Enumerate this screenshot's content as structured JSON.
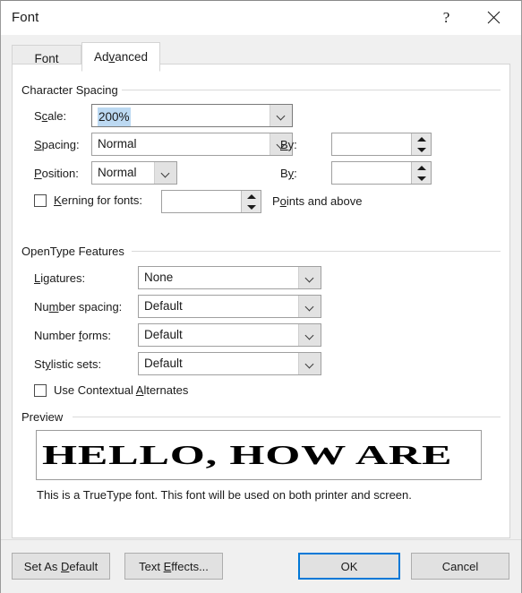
{
  "window": {
    "title": "Font",
    "help_icon": "question-mark-icon",
    "close_icon": "close-icon"
  },
  "tabs": [
    {
      "label": "Font",
      "accel": "n",
      "active": false
    },
    {
      "label": "Advanced",
      "accel": "v",
      "active": true
    }
  ],
  "character_spacing": {
    "group_label": "Character Spacing",
    "scale": {
      "label": "Scale:",
      "accel": "c",
      "value": "200%",
      "selected": true,
      "arrow_icon": "chevron-down-icon"
    },
    "spacing": {
      "label": "Spacing:",
      "accel": "S",
      "value": "Normal",
      "arrow_icon": "chevron-down-icon",
      "by_label": "By:",
      "by_value": "",
      "by_accel": "B"
    },
    "position": {
      "label": "Position:",
      "accel": "P",
      "value": "Normal",
      "arrow_icon": "chevron-down-icon",
      "by_label": "By:",
      "by_value": "",
      "by_accel": "y"
    },
    "kerning": {
      "label": "Kerning for fonts:",
      "accel": "K",
      "checked": false,
      "value": "",
      "suffix": "Points and above",
      "suffix_accel": "o"
    }
  },
  "opentype": {
    "group_label": "OpenType Features",
    "fields": [
      {
        "label": "Ligatures:",
        "accel": "L",
        "value": "None",
        "arrow_icon": "chevron-down-icon"
      },
      {
        "label": "Number spacing:",
        "accel": "m",
        "value": "Default",
        "arrow_icon": "chevron-down-icon"
      },
      {
        "label": "Number forms:",
        "accel": "f",
        "value": "Default",
        "arrow_icon": "chevron-down-icon"
      },
      {
        "label": "Stylistic sets:",
        "accel": "y",
        "value": "Default",
        "arrow_icon": "chevron-down-icon"
      }
    ],
    "contextual_alternates": {
      "label": "Use Contextual Alternates",
      "accel": "A",
      "checked": false
    }
  },
  "preview": {
    "group_label": "Preview",
    "sample_text": "HELLO, HOW ARE",
    "note": "This is a TrueType font. This font will be used on both printer and screen."
  },
  "footer": {
    "set_as_default": {
      "label": "Set As Default",
      "accel": "D"
    },
    "text_effects": {
      "label": "Text Effects...",
      "accel": "E"
    },
    "ok": {
      "label": "OK",
      "default": true
    },
    "cancel": {
      "label": "Cancel"
    }
  },
  "colors": {
    "accent": "#0078d7",
    "selection": "#bcd9f2",
    "dialog_bg": "#f0f0f0",
    "panel_bg": "#ffffff",
    "control_bg": "#e1e1e1"
  }
}
